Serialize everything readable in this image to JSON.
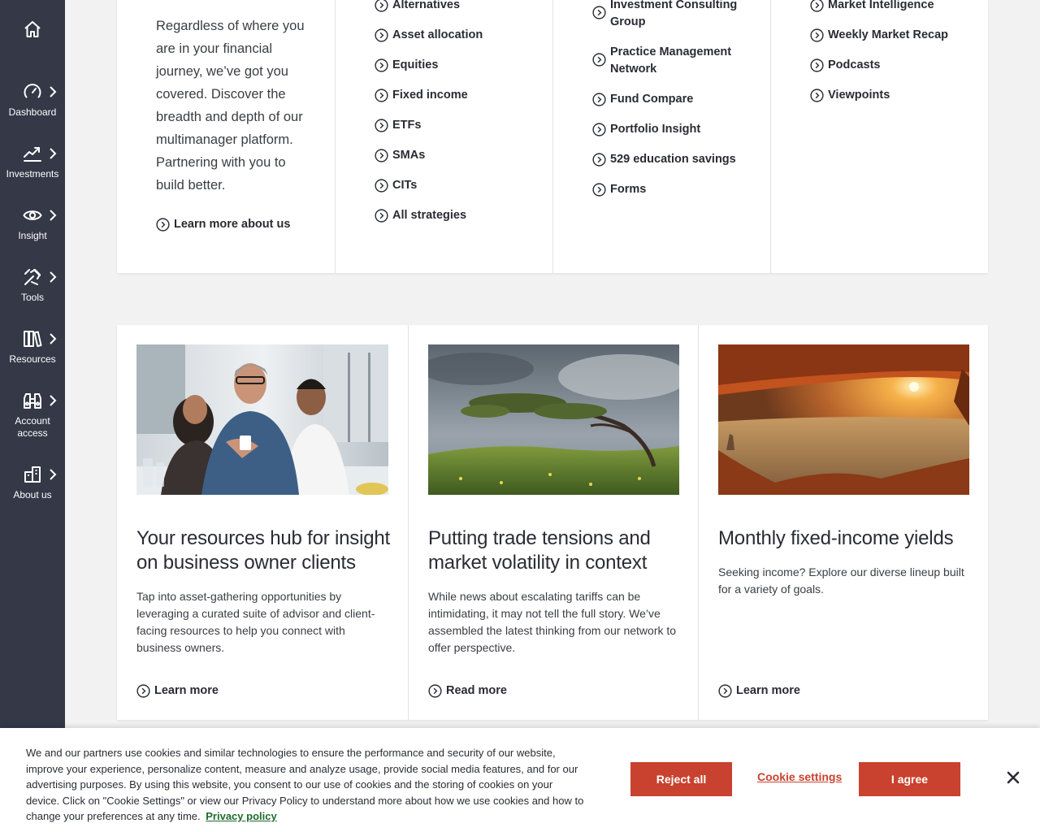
{
  "sidebar": {
    "home_icon": "home-icon",
    "items": [
      {
        "label": "Dashboard",
        "icon": "gauge-icon"
      },
      {
        "label": "Investments",
        "icon": "trend-chart-icon"
      },
      {
        "label": "Insight",
        "icon": "eye-icon"
      },
      {
        "label": "Tools",
        "icon": "tools-icon"
      },
      {
        "label": "Resources",
        "icon": "books-icon"
      },
      {
        "label": "Account access",
        "icon": "binoculars-icon"
      },
      {
        "label": "About us",
        "icon": "building-icon"
      }
    ]
  },
  "top_menu": {
    "intro_text": "Regardless of where you are in your financial journey, we’ve got you covered. Discover the breadth and depth of our multimanager platform. Partnering with you to build better.",
    "intro_link": "Learn more about us",
    "investments_links": [
      "Alternatives",
      "Asset allocation",
      "Equities",
      "Fixed income",
      "ETFs",
      "SMAs",
      "CITs",
      "All strategies"
    ],
    "tools_links": [
      "Investment Consulting Group",
      "Practice Management Network",
      "Fund Compare",
      "Portfolio Insight",
      "529 education savings",
      "Forms"
    ],
    "insight_links": [
      "Market Intelligence",
      "Weekly Market Recap",
      "Podcasts",
      "Viewpoints"
    ]
  },
  "cards": [
    {
      "title": "Your resources hub for insight on business owner clients",
      "body": "Tap into asset-gathering opportunities by leveraging a curated suite of advisor and client-facing resources to help you connect with business owners.",
      "link": "Learn more"
    },
    {
      "title": "Putting trade tensions and market volatility in context",
      "body": "While news about escalating tariffs can be intimidating, it may not tell the full story. We’ve assembled the latest thinking from our network to offer perspective.",
      "link": "Read more"
    },
    {
      "title": "Monthly fixed-income yields",
      "body": "Seeking income? Explore our diverse lineup built for a variety of goals.",
      "link": "Learn more"
    }
  ],
  "cookie_banner": {
    "message": "We and our partners use cookies and similar technologies to ensure the performance and security of our website, improve your experience, personalize content, measure and analyze usage, provide social media features, and for our advertising purposes. By using this website, you consent to our use of cookies and the storing of cookies on your device. Click on \"Cookie Settings\" or view our Privacy Policy to understand more about how we use cookies and how to change your preferences at any time.",
    "privacy_link": "Privacy policy",
    "reject_label": "Reject all",
    "settings_label": "Cookie settings",
    "agree_label": "I agree"
  },
  "colors": {
    "sidebar_bg": "#343847",
    "accent_red": "#c9422f",
    "privacy_link_green": "#1e6b2c",
    "page_bg": "#f2f2f2"
  }
}
